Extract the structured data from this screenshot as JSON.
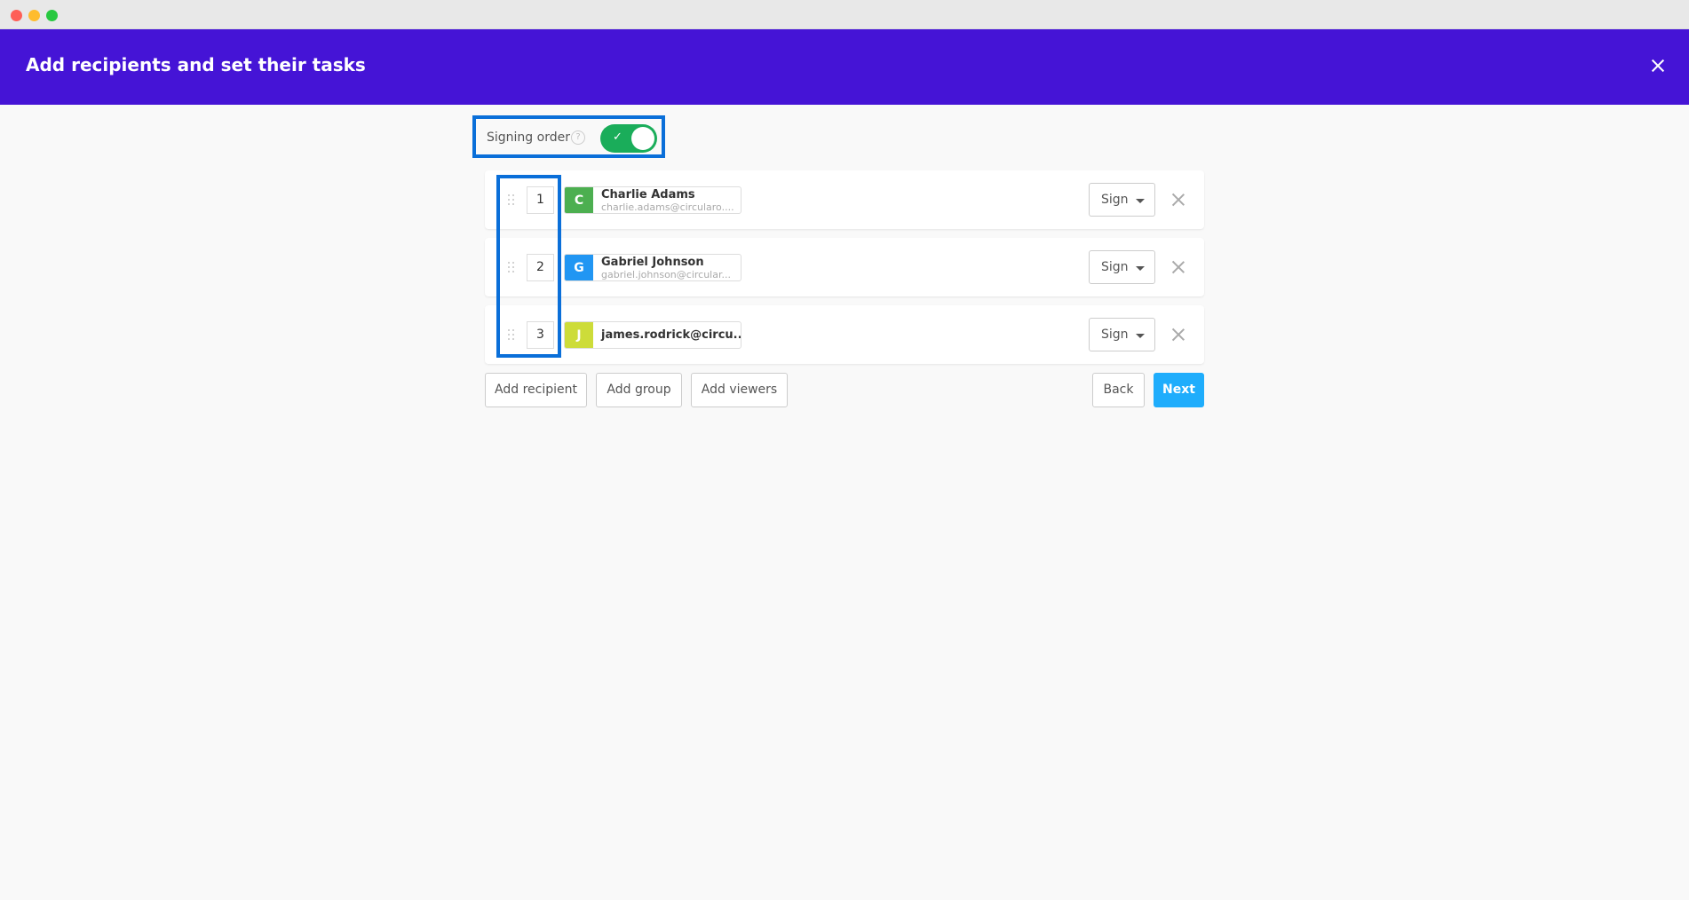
{
  "window": {
    "controls": [
      "close",
      "minimize",
      "maximize"
    ]
  },
  "header": {
    "title": "Add recipients and set their tasks",
    "close_icon": "close-icon",
    "color": "#4514d6"
  },
  "signing_order": {
    "label": "Signing order",
    "help_icon": "?",
    "toggle_on": true,
    "toggle_check": "✓",
    "toggle_color": "#1aad5a"
  },
  "recipients": [
    {
      "order": "1",
      "initial": "C",
      "avatar_color": "#4caf50",
      "name": "Charlie Adams",
      "email": "charlie.adams@circularo....",
      "task": "Sign"
    },
    {
      "order": "2",
      "initial": "G",
      "avatar_color": "#2196f3",
      "name": "Gabriel Johnson",
      "email": "gabriel.johnson@circular...",
      "task": "Sign"
    },
    {
      "order": "3",
      "initial": "J",
      "avatar_color": "#cddc39",
      "name": "",
      "email": "james.rodrick@circu...",
      "task": "Sign"
    }
  ],
  "actions": {
    "add_recipient": "Add recipient",
    "add_group": "Add group",
    "add_viewers": "Add viewers",
    "back": "Back",
    "next": "Next"
  },
  "highlight_color": "#0a6fd9"
}
